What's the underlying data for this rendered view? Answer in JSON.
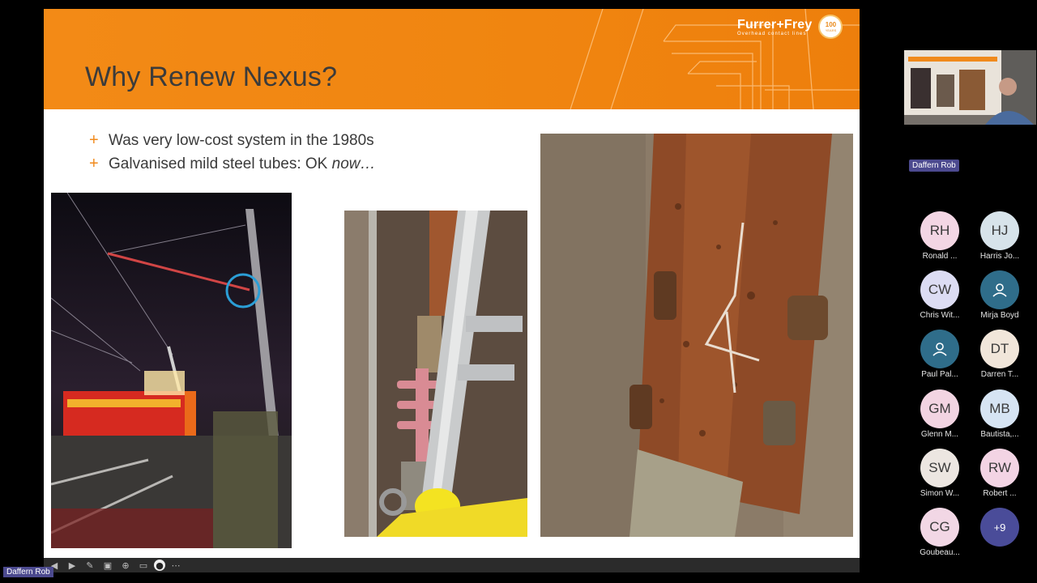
{
  "slide": {
    "title": "Why Renew Nexus?",
    "logo": {
      "name": "Furrer+Frey",
      "tagline": "Overhead contact lines",
      "badge_number": "100",
      "badge_word": "YEARS"
    },
    "bullets": [
      {
        "text": "Was very low-cost system in the 1980s",
        "emphasis": ""
      },
      {
        "text": "Galvanised mild steel tubes: OK ",
        "emphasis": "now…"
      }
    ],
    "bullet_marker": "+",
    "accent_color": "#f08a1c",
    "photos": [
      {
        "icon": "night-railway-photo"
      },
      {
        "icon": "insulator-and-tube-photo"
      },
      {
        "icon": "rusted-tube-closeup-photo"
      }
    ]
  },
  "toolbar": {
    "buttons": [
      "prev-icon",
      "next-icon",
      "pen-icon",
      "slides-icon",
      "zoom-icon",
      "subtitles-icon",
      "camera-icon",
      "more-icon"
    ]
  },
  "meeting": {
    "active_speaker": "Daffern Rob",
    "self_label": "Daffern Rob",
    "participants": [
      {
        "initials": "RH",
        "name": "Ronald ...",
        "color": "#f3d6e4"
      },
      {
        "initials": "HJ",
        "name": "Harris Jo...",
        "color": "#d7e3ea"
      },
      {
        "initials": "CW",
        "name": "Chris Wit...",
        "color": "#dcdcf3"
      },
      {
        "initials": "",
        "name": "Mirja Boyd",
        "color": "#2f6d8a",
        "icon": "person-icon"
      },
      {
        "initials": "",
        "name": "Paul Pal...",
        "color": "#2f6d8a",
        "icon": "person-icon"
      },
      {
        "initials": "DT",
        "name": "Darren T...",
        "color": "#f1e6da"
      },
      {
        "initials": "GM",
        "name": "Glenn M...",
        "color": "#f2d4e2"
      },
      {
        "initials": "MB",
        "name": "Bautista,...",
        "color": "#d6e4f3"
      },
      {
        "initials": "SW",
        "name": "Simon W...",
        "color": "#ece6e1"
      },
      {
        "initials": "RW",
        "name": "Robert ...",
        "color": "#f3d4e4"
      },
      {
        "initials": "CG",
        "name": "Goubeau...",
        "color": "#f2d7e5"
      },
      {
        "initials": "+9",
        "name": "",
        "color": "#4a4c99"
      }
    ]
  }
}
